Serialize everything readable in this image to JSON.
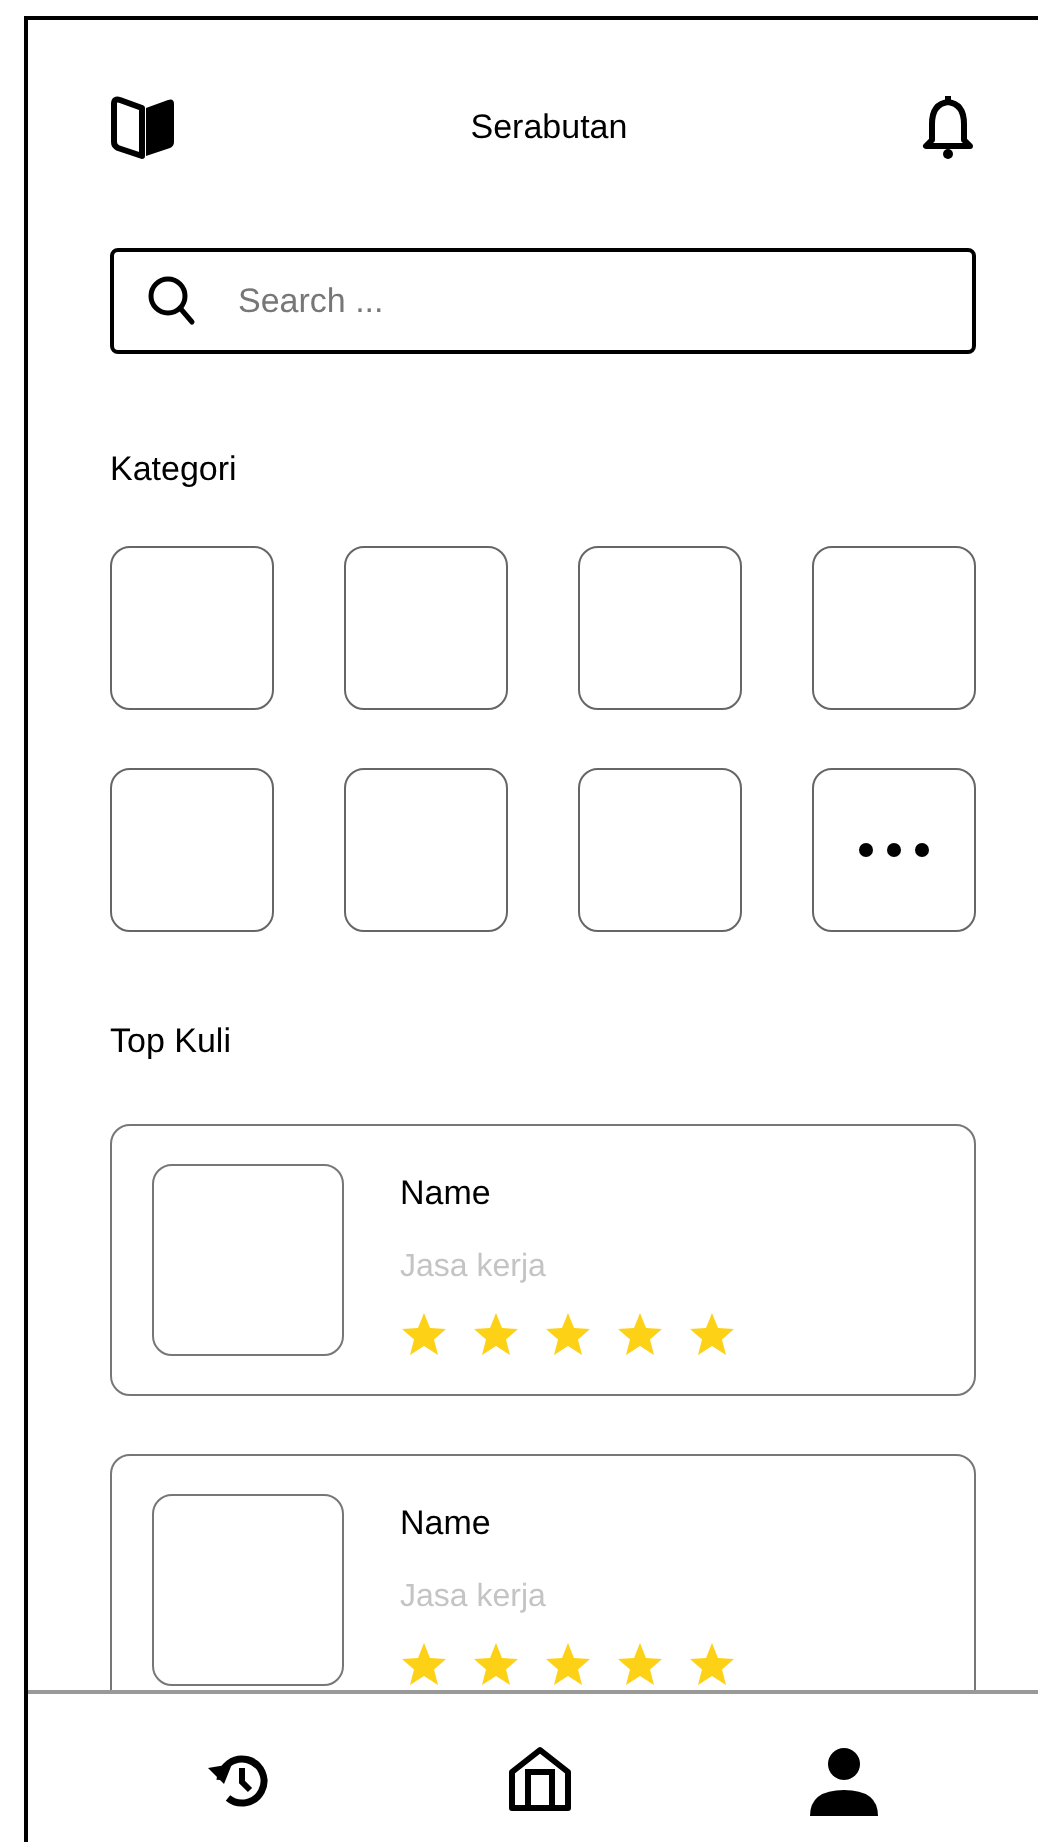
{
  "header": {
    "title": "Serabutan"
  },
  "search": {
    "placeholder": "Search ..."
  },
  "categories_section": {
    "title": "Kategori"
  },
  "categories": [
    {
      "kind": "empty"
    },
    {
      "kind": "empty"
    },
    {
      "kind": "empty"
    },
    {
      "kind": "empty"
    },
    {
      "kind": "empty"
    },
    {
      "kind": "empty"
    },
    {
      "kind": "empty"
    },
    {
      "kind": "more"
    }
  ],
  "top_section": {
    "title": "Top Kuli"
  },
  "workers": [
    {
      "name": "Name",
      "service": "Jasa kerja",
      "stars": 5
    },
    {
      "name": "Name",
      "service": "Jasa kerja",
      "stars": 5
    }
  ]
}
